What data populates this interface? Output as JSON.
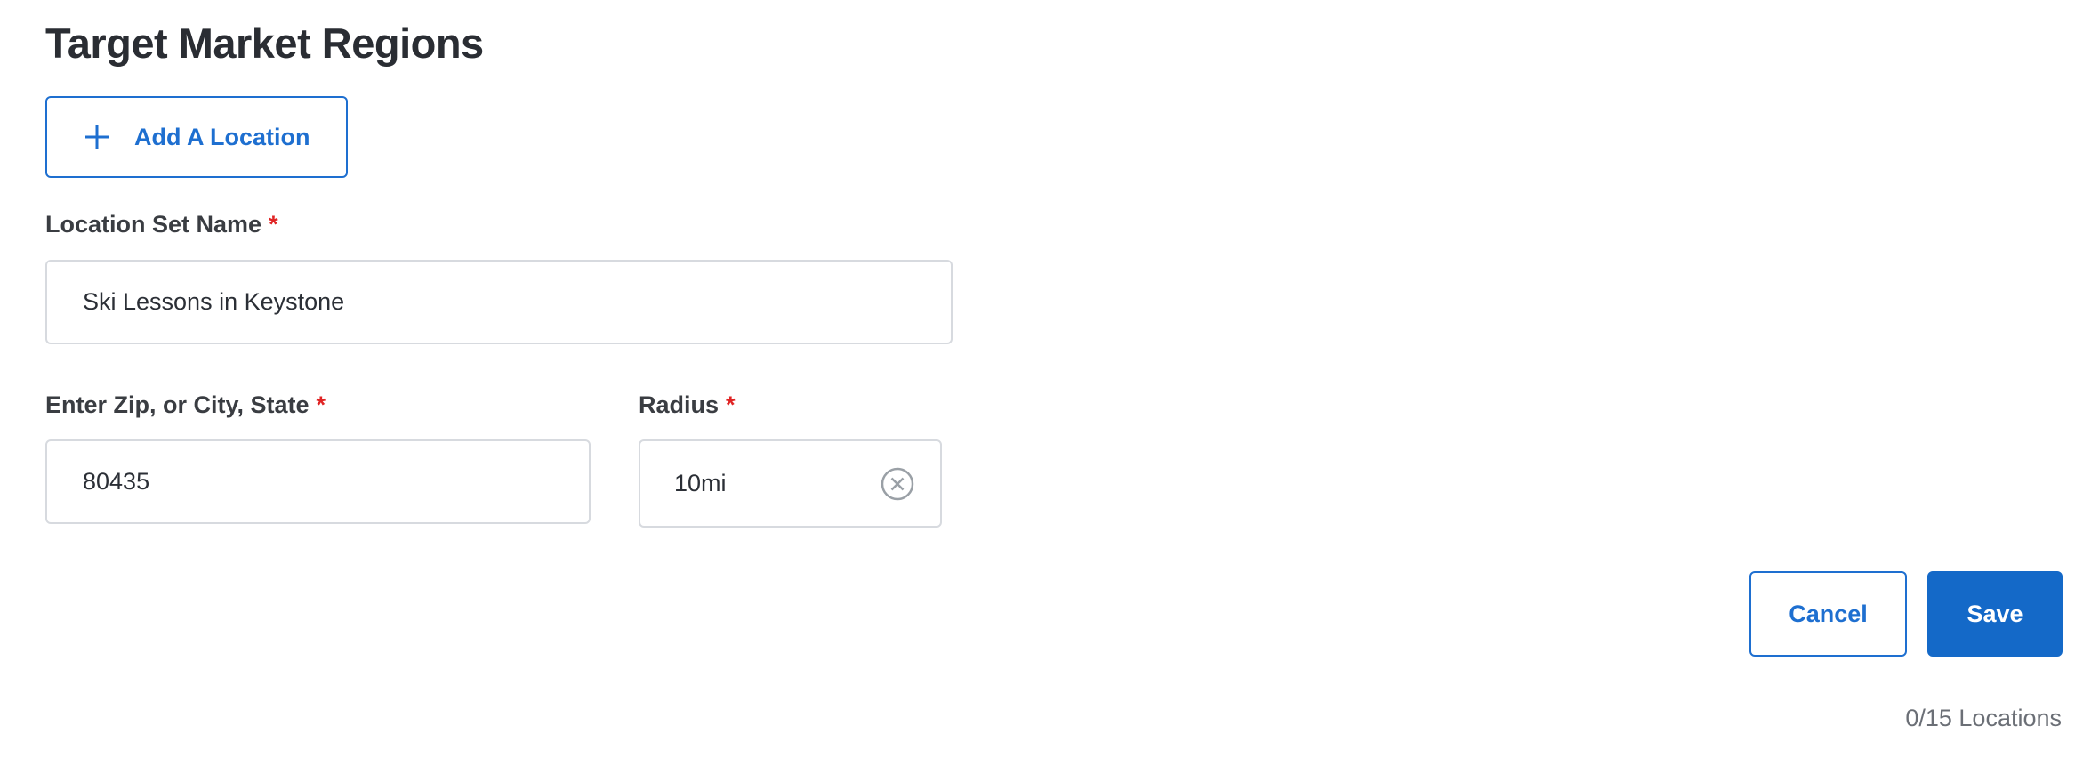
{
  "section": {
    "title": "Target Market Regions"
  },
  "add_location": {
    "label": "Add A Location",
    "icon": "plus-icon",
    "accent_color": "#1e6fd0"
  },
  "location_set_name": {
    "label": "Location Set Name",
    "required_marker": "*",
    "value": "Ski Lessons in Keystone"
  },
  "zip_city_state": {
    "label": "Enter Zip, or City, State",
    "required_marker": "*",
    "value": "80435"
  },
  "radius": {
    "label": "Radius",
    "required_marker": "*",
    "value": "10mi",
    "clear_icon": "clear-circle-icon"
  },
  "actions": {
    "cancel_label": "Cancel",
    "save_label": "Save",
    "primary_color": "#1469c8"
  },
  "footer": {
    "locations_count": "0/15 Locations"
  },
  "colors": {
    "required": "#e02424",
    "border": "#d7dadf"
  }
}
